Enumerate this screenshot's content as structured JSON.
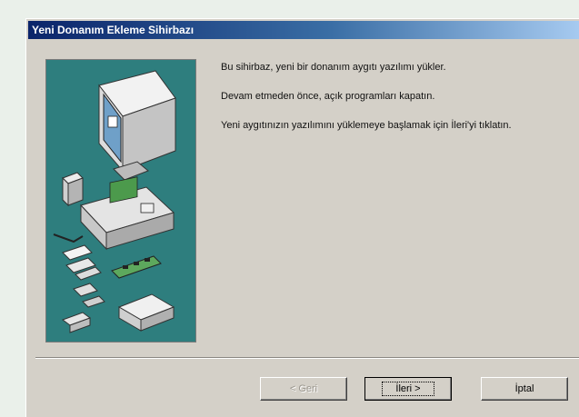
{
  "window": {
    "title": "Yeni Donanım Ekleme Sihirbazı"
  },
  "content": {
    "paragraphs": [
      "Bu sihirbaz, yeni bir donanım aygıtı yazılımı yükler.",
      "Devam etmeden önce, açık programları kapatın.",
      "Yeni aygıtınızın yazılımını yüklemeye başlamak için İleri'yi tıklatın."
    ]
  },
  "buttons": {
    "back_label": "< Geri",
    "next_label": "İleri >",
    "cancel_label": "İptal"
  },
  "illustration": {
    "icon": "hardware-devices-illustration",
    "background_color": "#2e7e7e"
  }
}
